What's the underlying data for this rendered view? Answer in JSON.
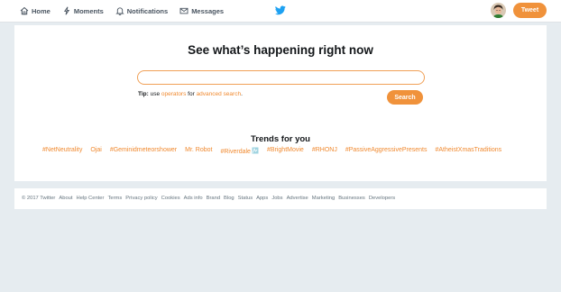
{
  "nav": {
    "items": [
      {
        "label": "Home",
        "icon": "home-icon"
      },
      {
        "label": "Moments",
        "icon": "lightning-icon"
      },
      {
        "label": "Notifications",
        "icon": "bell-icon"
      },
      {
        "label": "Messages",
        "icon": "envelope-icon"
      }
    ],
    "tweet_label": "Tweet"
  },
  "main": {
    "headline": "See what’s happening right now",
    "search_value": "",
    "tip_prefix": "Tip:",
    "tip_use": " use ",
    "tip_operators": "operators",
    "tip_for": " for ",
    "tip_advanced": "advanced search",
    "tip_end": ".",
    "search_button": "Search"
  },
  "trends": {
    "title": "Trends for you",
    "items": [
      "#NetNeutrality",
      "Ojai",
      "#Geminidmeteorshower",
      "Mr. Robot",
      "#Riverdale",
      "#BrightMovie",
      "#RHONJ",
      "#PassiveAggressivePresents",
      "#AtheistXmasTraditions"
    ]
  },
  "footer": {
    "links": [
      "© 2017 Twitter",
      "About",
      "Help Center",
      "Terms",
      "Privacy policy",
      "Cookies",
      "Ads info",
      "Brand",
      "Blog",
      "Status",
      "Apps",
      "Jobs",
      "Advertise",
      "Marketing",
      "Businesses",
      "Developers"
    ]
  },
  "colors": {
    "accent": "#f0923b",
    "link": "#f0892f",
    "bird": "#1da1f2",
    "background": "#e6ecf0"
  }
}
